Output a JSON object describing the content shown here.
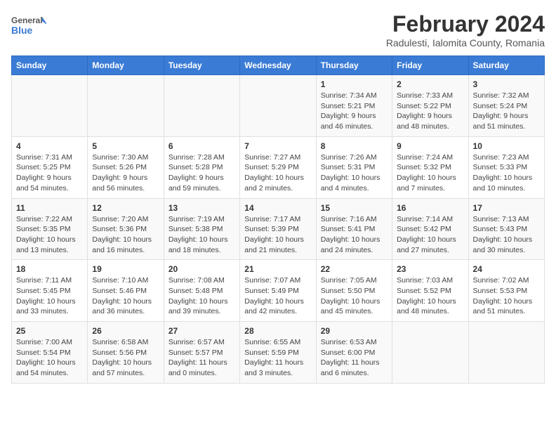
{
  "logo": {
    "general": "General",
    "blue": "Blue"
  },
  "header": {
    "month": "February 2024",
    "location": "Radulesti, Ialomita County, Romania"
  },
  "weekdays": [
    "Sunday",
    "Monday",
    "Tuesday",
    "Wednesday",
    "Thursday",
    "Friday",
    "Saturday"
  ],
  "weeks": [
    [
      {
        "day": "",
        "info": ""
      },
      {
        "day": "",
        "info": ""
      },
      {
        "day": "",
        "info": ""
      },
      {
        "day": "",
        "info": ""
      },
      {
        "day": "1",
        "info": "Sunrise: 7:34 AM\nSunset: 5:21 PM\nDaylight: 9 hours\nand 46 minutes."
      },
      {
        "day": "2",
        "info": "Sunrise: 7:33 AM\nSunset: 5:22 PM\nDaylight: 9 hours\nand 48 minutes."
      },
      {
        "day": "3",
        "info": "Sunrise: 7:32 AM\nSunset: 5:24 PM\nDaylight: 9 hours\nand 51 minutes."
      }
    ],
    [
      {
        "day": "4",
        "info": "Sunrise: 7:31 AM\nSunset: 5:25 PM\nDaylight: 9 hours\nand 54 minutes."
      },
      {
        "day": "5",
        "info": "Sunrise: 7:30 AM\nSunset: 5:26 PM\nDaylight: 9 hours\nand 56 minutes."
      },
      {
        "day": "6",
        "info": "Sunrise: 7:28 AM\nSunset: 5:28 PM\nDaylight: 9 hours\nand 59 minutes."
      },
      {
        "day": "7",
        "info": "Sunrise: 7:27 AM\nSunset: 5:29 PM\nDaylight: 10 hours\nand 2 minutes."
      },
      {
        "day": "8",
        "info": "Sunrise: 7:26 AM\nSunset: 5:31 PM\nDaylight: 10 hours\nand 4 minutes."
      },
      {
        "day": "9",
        "info": "Sunrise: 7:24 AM\nSunset: 5:32 PM\nDaylight: 10 hours\nand 7 minutes."
      },
      {
        "day": "10",
        "info": "Sunrise: 7:23 AM\nSunset: 5:33 PM\nDaylight: 10 hours\nand 10 minutes."
      }
    ],
    [
      {
        "day": "11",
        "info": "Sunrise: 7:22 AM\nSunset: 5:35 PM\nDaylight: 10 hours\nand 13 minutes."
      },
      {
        "day": "12",
        "info": "Sunrise: 7:20 AM\nSunset: 5:36 PM\nDaylight: 10 hours\nand 16 minutes."
      },
      {
        "day": "13",
        "info": "Sunrise: 7:19 AM\nSunset: 5:38 PM\nDaylight: 10 hours\nand 18 minutes."
      },
      {
        "day": "14",
        "info": "Sunrise: 7:17 AM\nSunset: 5:39 PM\nDaylight: 10 hours\nand 21 minutes."
      },
      {
        "day": "15",
        "info": "Sunrise: 7:16 AM\nSunset: 5:41 PM\nDaylight: 10 hours\nand 24 minutes."
      },
      {
        "day": "16",
        "info": "Sunrise: 7:14 AM\nSunset: 5:42 PM\nDaylight: 10 hours\nand 27 minutes."
      },
      {
        "day": "17",
        "info": "Sunrise: 7:13 AM\nSunset: 5:43 PM\nDaylight: 10 hours\nand 30 minutes."
      }
    ],
    [
      {
        "day": "18",
        "info": "Sunrise: 7:11 AM\nSunset: 5:45 PM\nDaylight: 10 hours\nand 33 minutes."
      },
      {
        "day": "19",
        "info": "Sunrise: 7:10 AM\nSunset: 5:46 PM\nDaylight: 10 hours\nand 36 minutes."
      },
      {
        "day": "20",
        "info": "Sunrise: 7:08 AM\nSunset: 5:48 PM\nDaylight: 10 hours\nand 39 minutes."
      },
      {
        "day": "21",
        "info": "Sunrise: 7:07 AM\nSunset: 5:49 PM\nDaylight: 10 hours\nand 42 minutes."
      },
      {
        "day": "22",
        "info": "Sunrise: 7:05 AM\nSunset: 5:50 PM\nDaylight: 10 hours\nand 45 minutes."
      },
      {
        "day": "23",
        "info": "Sunrise: 7:03 AM\nSunset: 5:52 PM\nDaylight: 10 hours\nand 48 minutes."
      },
      {
        "day": "24",
        "info": "Sunrise: 7:02 AM\nSunset: 5:53 PM\nDaylight: 10 hours\nand 51 minutes."
      }
    ],
    [
      {
        "day": "25",
        "info": "Sunrise: 7:00 AM\nSunset: 5:54 PM\nDaylight: 10 hours\nand 54 minutes."
      },
      {
        "day": "26",
        "info": "Sunrise: 6:58 AM\nSunset: 5:56 PM\nDaylight: 10 hours\nand 57 minutes."
      },
      {
        "day": "27",
        "info": "Sunrise: 6:57 AM\nSunset: 5:57 PM\nDaylight: 11 hours\nand 0 minutes."
      },
      {
        "day": "28",
        "info": "Sunrise: 6:55 AM\nSunset: 5:59 PM\nDaylight: 11 hours\nand 3 minutes."
      },
      {
        "day": "29",
        "info": "Sunrise: 6:53 AM\nSunset: 6:00 PM\nDaylight: 11 hours\nand 6 minutes."
      },
      {
        "day": "",
        "info": ""
      },
      {
        "day": "",
        "info": ""
      }
    ]
  ]
}
